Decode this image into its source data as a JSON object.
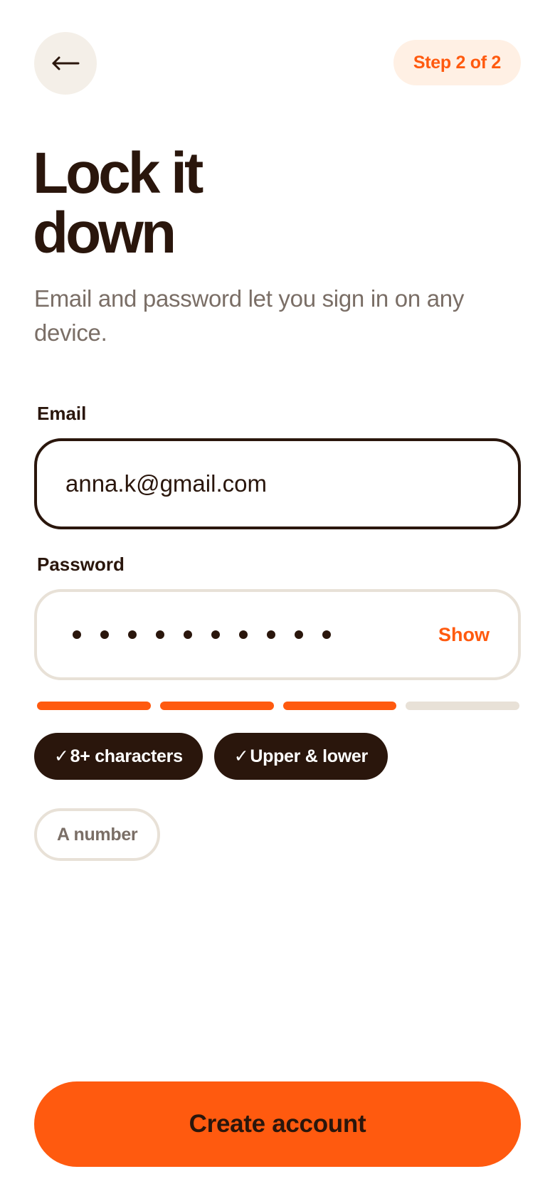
{
  "header": {
    "back_icon": "arrow-left-icon",
    "step_label": "Step 2 of 2"
  },
  "title": {
    "line1": "Lock it",
    "line2": "down"
  },
  "subtitle": "Email and password let you sign in on any device.",
  "email": {
    "label": "Email",
    "value": "anna.k@gmail.com"
  },
  "password": {
    "label": "Password",
    "masked_length": 10,
    "toggle_label": "Show"
  },
  "strength": {
    "filled": 3,
    "total": 4
  },
  "requirements": [
    {
      "label": "8+ characters",
      "met": true
    },
    {
      "label": "Upper & lower",
      "met": true
    },
    {
      "label": "A number",
      "met": false
    }
  ],
  "check_glyph": "✓",
  "cta_label": "Create account",
  "colors": {
    "accent": "#ff5a0f",
    "text_dark": "#2a160c",
    "muted": "#7a6e66",
    "border_light": "#e8e1d7",
    "pill_bg": "#fff0e4"
  }
}
